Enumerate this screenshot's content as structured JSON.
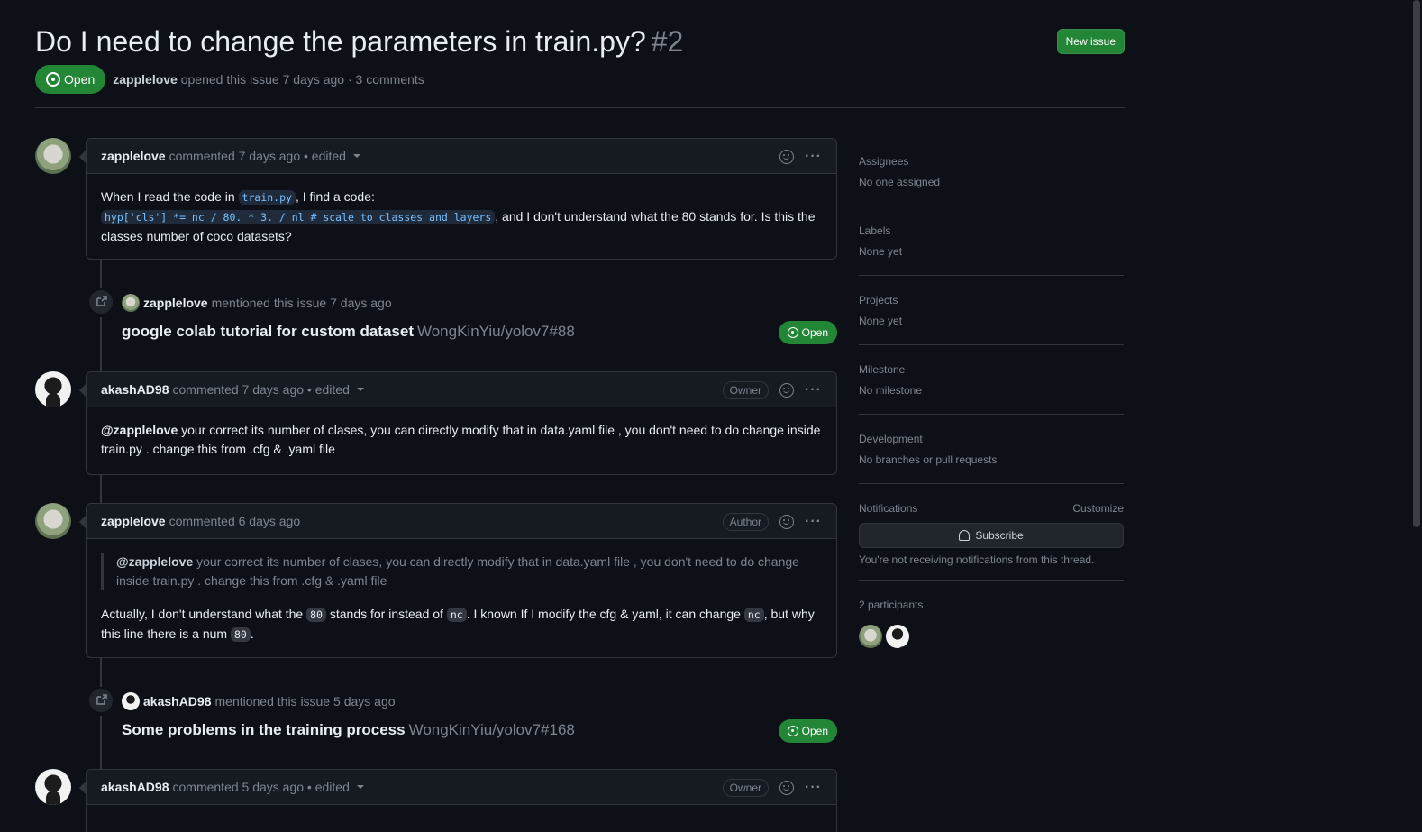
{
  "issue": {
    "title": "Do I need to change the parameters in train.py?",
    "number": "#2",
    "new_issue_label": "New issue",
    "state": "Open",
    "author": "zapplelove",
    "meta": "opened this issue 7 days ago · 3 comments"
  },
  "timeline": {
    "c1": {
      "author": "zapplelove",
      "meta": "commented 7 days ago • edited",
      "t1": "When I read the code in ",
      "code1": "train.py",
      "t2": ", I find a code:",
      "code2": "hyp['cls'] *= nc / 80. * 3. / nl # scale to classes and layers",
      "t3": ", and I don't understand what the 80 stands for. Is this the classes number of coco datasets?"
    },
    "e1": {
      "who": "zapplelove",
      "what": "mentioned this issue 7 days ago",
      "ref_title": "google colab tutorial for custom dataset",
      "ref_repo": "WongKinYiu/yolov7#88",
      "state": "Open"
    },
    "c2": {
      "author": "akashAD98",
      "meta": "commented 7 days ago • edited",
      "role": "Owner",
      "mention": "@zapplelove",
      "text": " your correct its number of clases, you can directly modify that in data.yaml file , you don't need to do change inside train.py . change this from .cfg & .yaml file"
    },
    "c3": {
      "author": "zapplelove",
      "meta": "commented 6 days ago",
      "role": "Author",
      "quote_mention": "@zapplelove",
      "quote_text": " your correct its number of clases, you can directly modify that in data.yaml file , you don't need to do change inside train.py . change this from .cfg & .yaml file",
      "t1": "Actually, I don't understand what the ",
      "code1": "80",
      "t2": " stands for instead of ",
      "code2": "nc",
      "t3": ". I known If I modify the cfg & yaml, it can change ",
      "code3": "nc",
      "t4": ", but why this line there is a num ",
      "code4": "80",
      "t5": "."
    },
    "e2": {
      "who": "akashAD98",
      "what": "mentioned this issue 5 days ago",
      "ref_title": "Some problems in the training process",
      "ref_repo": "WongKinYiu/yolov7#168",
      "state": "Open"
    },
    "c4": {
      "author": "akashAD98",
      "meta": "commented 5 days ago • edited",
      "role": "Owner"
    }
  },
  "sidebar": {
    "assignees_label": "Assignees",
    "assignees_value": "No one assigned",
    "labels_label": "Labels",
    "labels_value": "None yet",
    "projects_label": "Projects",
    "projects_value": "None yet",
    "milestone_label": "Milestone",
    "milestone_value": "No milestone",
    "development_label": "Development",
    "development_value": "No branches or pull requests",
    "notifications_label": "Notifications",
    "customize_label": "Customize",
    "subscribe_label": "Subscribe",
    "notifications_note": "You're not receiving notifications from this thread.",
    "participants_label": "2 participants"
  },
  "colors": {
    "background": "#0d1117",
    "green": "#238636",
    "border": "#30363d",
    "muted": "#7d8590"
  }
}
